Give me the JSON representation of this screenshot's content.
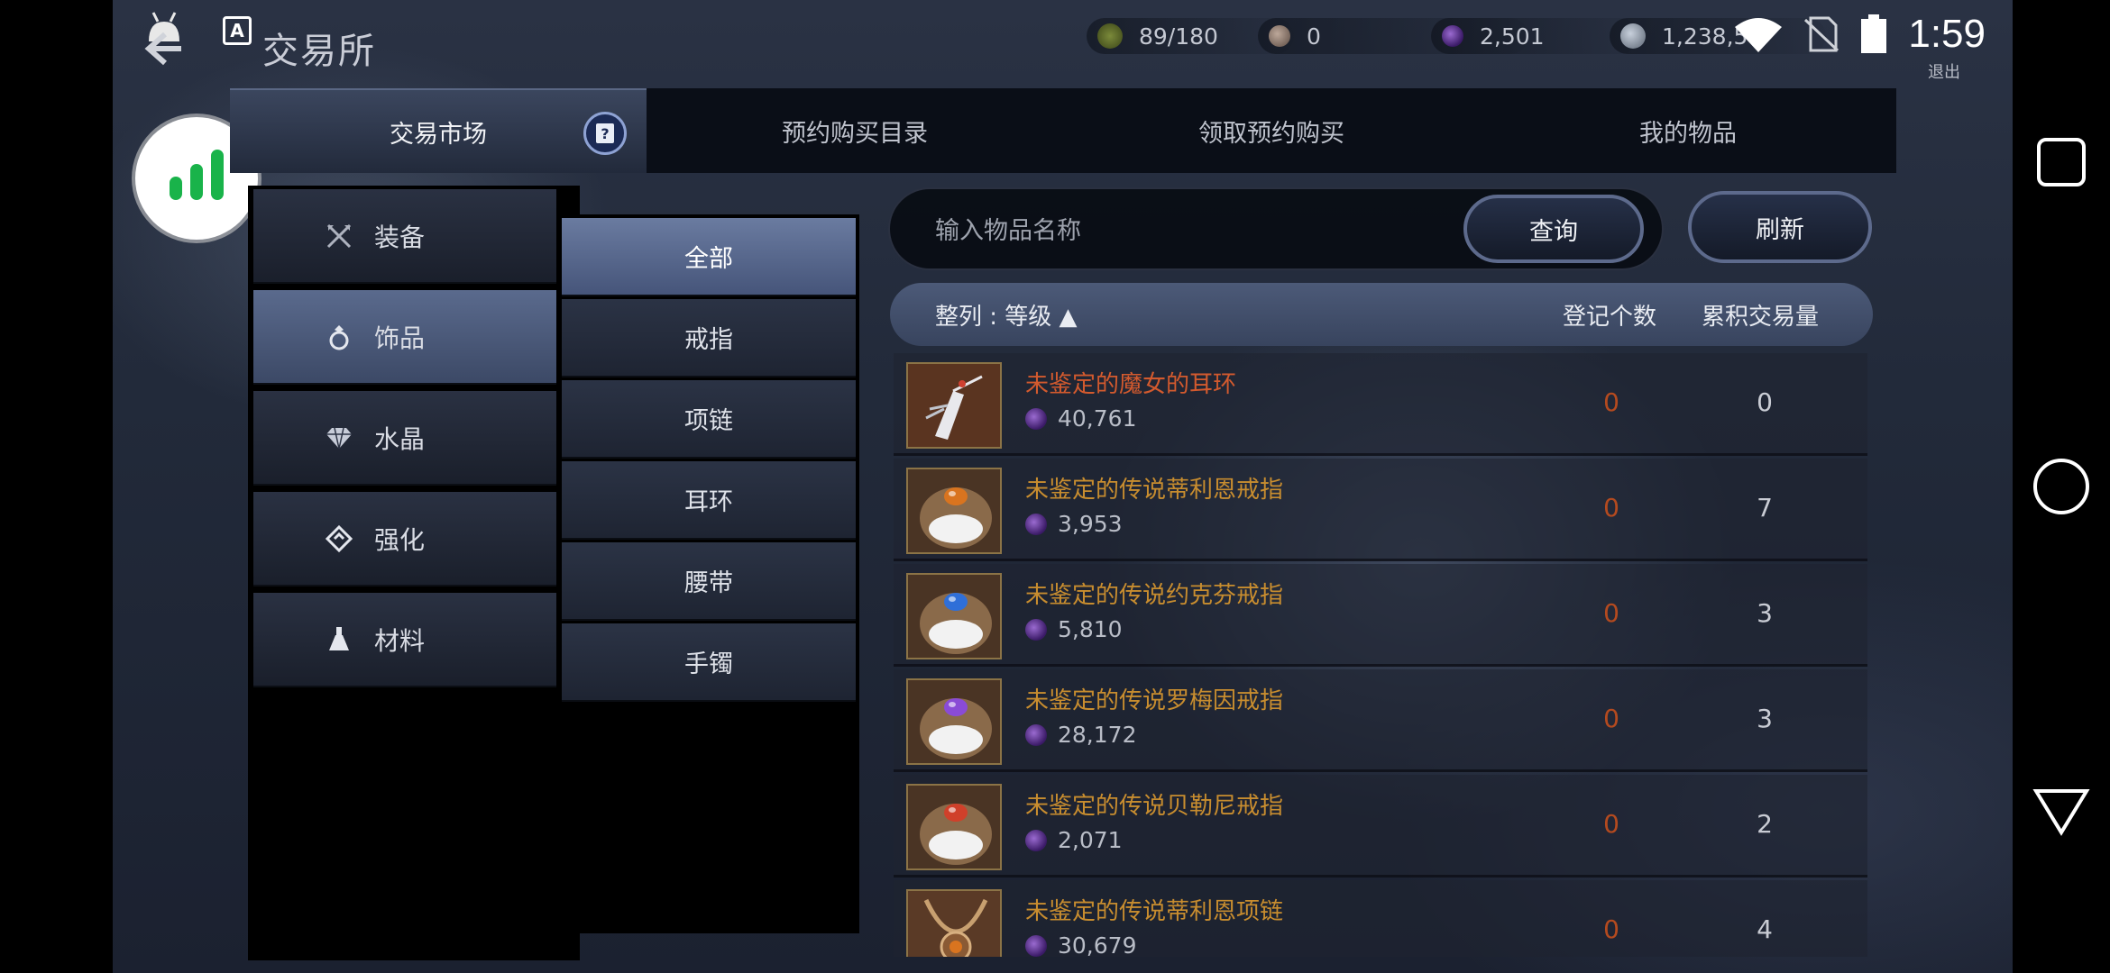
{
  "header": {
    "title": "交易所",
    "exit_label": "退出",
    "clock": "1:59"
  },
  "resources": [
    {
      "icon": "stamina-icon",
      "value": "89/180"
    },
    {
      "icon": "stone-icon",
      "value": "0"
    },
    {
      "icon": "purple-gem-icon",
      "value": "2,501"
    },
    {
      "icon": "silver-coin-icon",
      "value": "1,238,5"
    }
  ],
  "tabs": [
    {
      "label": "交易市场",
      "active": true
    },
    {
      "label": "预约购买目录"
    },
    {
      "label": "领取预约购买"
    },
    {
      "label": "我的物品"
    }
  ],
  "categories": [
    {
      "label": "装备",
      "icon": "crossed-swords-icon"
    },
    {
      "label": "饰品",
      "icon": "ring-icon",
      "active": true
    },
    {
      "label": "水晶",
      "icon": "diamond-icon"
    },
    {
      "label": "强化",
      "icon": "enhance-icon"
    },
    {
      "label": "材料",
      "icon": "flask-icon"
    }
  ],
  "subcategories": [
    {
      "label": "全部",
      "active": true
    },
    {
      "label": "戒指"
    },
    {
      "label": "项链"
    },
    {
      "label": "耳环"
    },
    {
      "label": "腰带"
    },
    {
      "label": "手镯"
    }
  ],
  "search": {
    "placeholder": "输入物品名称",
    "query_label": "查询",
    "refresh_label": "刷新"
  },
  "list_header": {
    "sort_label": "整列 : 等级 ▲",
    "col_registered": "登记个数",
    "col_volume": "累积交易量"
  },
  "items": [
    {
      "name": "未鉴定的魔女的耳环",
      "price": "40,761",
      "registered": "0",
      "volume": "0",
      "thumb": "earring",
      "highlight": true
    },
    {
      "name": "未鉴定的传说蒂利恩戒指",
      "price": "3,953",
      "registered": "0",
      "volume": "7",
      "thumb": "ring",
      "gem": "#d9741f"
    },
    {
      "name": "未鉴定的传说约克芬戒指",
      "price": "5,810",
      "registered": "0",
      "volume": "3",
      "thumb": "ring",
      "gem": "#2f6fd8"
    },
    {
      "name": "未鉴定的传说罗梅因戒指",
      "price": "28,172",
      "registered": "0",
      "volume": "3",
      "thumb": "ring",
      "gem": "#8a4bd6"
    },
    {
      "name": "未鉴定的传说贝勒尼戒指",
      "price": "2,071",
      "registered": "0",
      "volume": "2",
      "thumb": "ring",
      "gem": "#d0402a"
    },
    {
      "name": "未鉴定的传说蒂利恩项链",
      "price": "30,679",
      "registered": "0",
      "volume": "4",
      "thumb": "necklace",
      "gem": "#d9741f"
    }
  ],
  "colors": {
    "item_name_legend": "#c88d2f",
    "item_name_highlight": "#d35a2e",
    "registered_zero": "#b44a1f"
  }
}
